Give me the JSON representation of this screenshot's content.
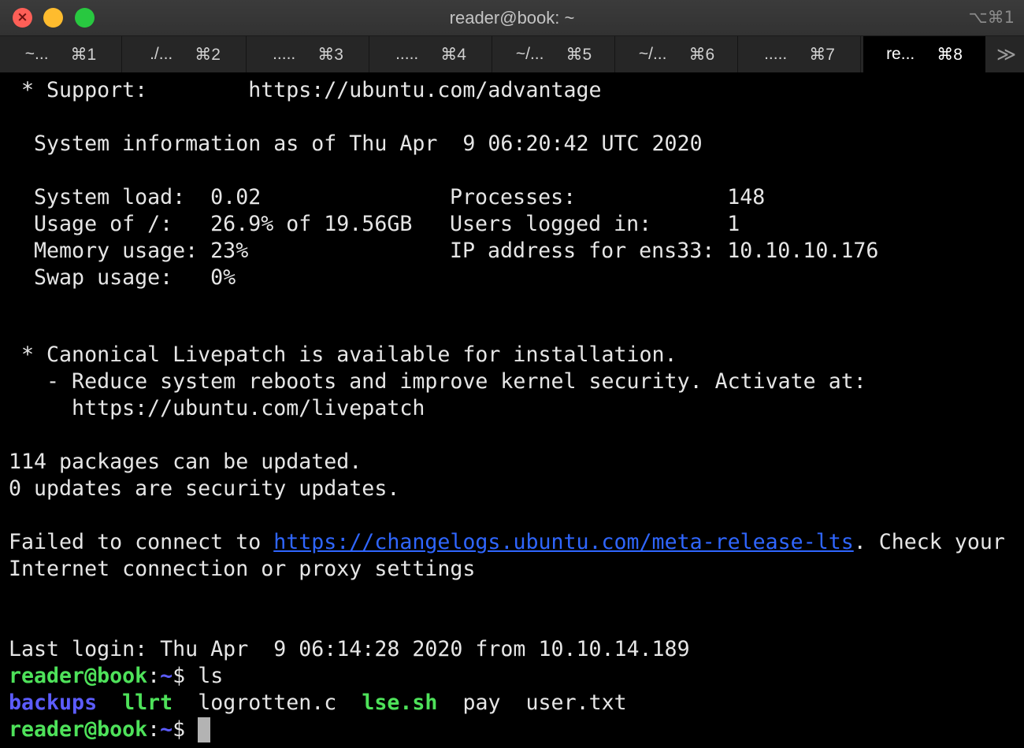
{
  "window": {
    "title": "reader@book: ~",
    "shortcut": "⌥⌘1"
  },
  "tabs": [
    {
      "label": "~...",
      "key": "⌘1"
    },
    {
      "label": "./...",
      "key": "⌘2"
    },
    {
      "label": ".....",
      "key": "⌘3"
    },
    {
      "label": ".....",
      "key": "⌘4"
    },
    {
      "label": "~/...",
      "key": "⌘5"
    },
    {
      "label": "~/...",
      "key": "⌘6"
    },
    {
      "label": ".....",
      "key": "⌘7"
    },
    {
      "label": "re...",
      "key": "⌘8"
    }
  ],
  "tab_overflow": "≫",
  "terminal": {
    "support": " * Support:        https://ubuntu.com/advantage",
    "sysinfo": "  System information as of Thu Apr  9 06:20:42 UTC 2020",
    "stats": [
      {
        "left": "  System load:  0.02",
        "right": "Processes:            148"
      },
      {
        "left": "  Usage of /:   26.9% of 19.56GB",
        "right": "Users logged in:      1"
      },
      {
        "left": "  Memory usage: 23%",
        "right": "IP address for ens33: 10.10.10.176"
      },
      {
        "left": "  Swap usage:   0%",
        "right": ""
      }
    ],
    "livepatch1": " * Canonical Livepatch is available for installation.",
    "livepatch2": "   - Reduce system reboots and improve kernel security. Activate at:",
    "livepatch3": "     https://ubuntu.com/livepatch",
    "packages": "114 packages can be updated.",
    "security": "0 updates are security updates.",
    "fail_prefix": "Failed to connect to ",
    "fail_link": "https://changelogs.ubuntu.com/meta-release-lts",
    "fail_suffix": ". Check your",
    "fail_line2": "Internet connection or proxy settings",
    "last_login": "Last login: Thu Apr  9 06:14:28 2020 from 10.10.14.189",
    "prompt_user": "reader@book",
    "prompt_colon": ":",
    "prompt_dir": "~",
    "prompt_sign": "$ ",
    "command": "ls",
    "ls_files": [
      {
        "name": "backups",
        "kind": "dir"
      },
      {
        "name": "llrt",
        "kind": "exec"
      },
      {
        "name": "logrotten.c",
        "kind": "file"
      },
      {
        "name": "lse.sh",
        "kind": "exec"
      },
      {
        "name": "pay",
        "kind": "file"
      },
      {
        "name": "user.txt",
        "kind": "file"
      }
    ]
  },
  "colors": {
    "prompt_user": "#4ee25a",
    "prompt_dir": "#5c5cff",
    "link": "#2f66ff",
    "directory": "#5c5cff",
    "executable": "#4ee25a"
  }
}
